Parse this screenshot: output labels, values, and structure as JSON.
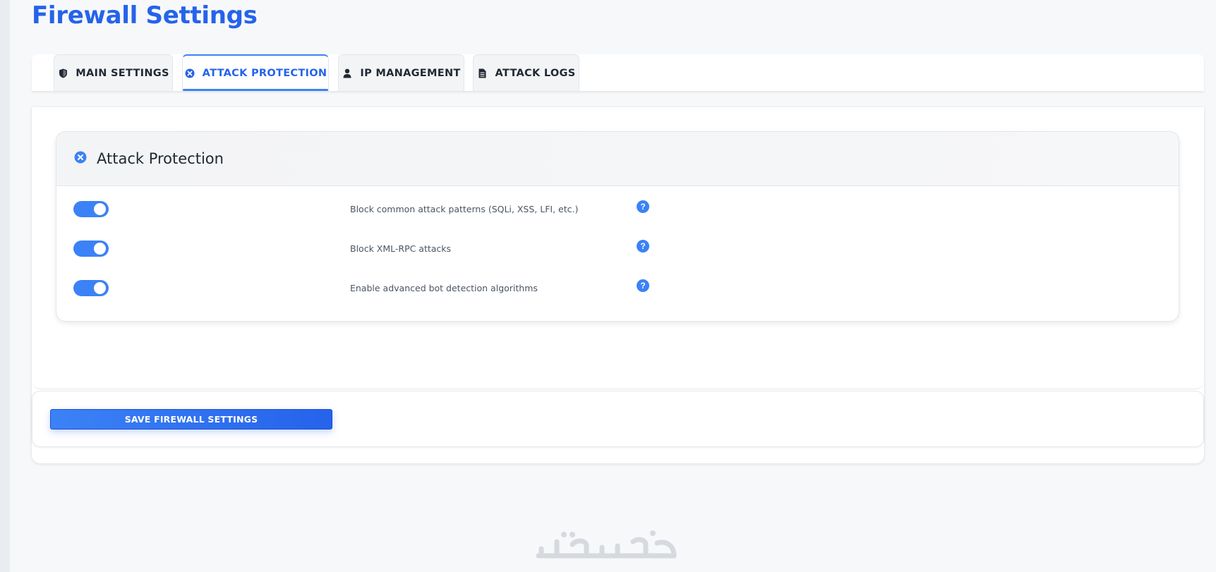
{
  "page": {
    "title": "Firewall Settings"
  },
  "tabs": [
    {
      "label": "MAIN SETTINGS",
      "icon": "shield-icon",
      "active": false
    },
    {
      "label": "ATTACK PROTECTION",
      "icon": "circle-x-icon",
      "active": true
    },
    {
      "label": "IP MANAGEMENT",
      "icon": "user-icon",
      "active": false
    },
    {
      "label": "ATTACK LOGS",
      "icon": "document-icon",
      "active": false
    }
  ],
  "card": {
    "title": "Attack Protection",
    "icon": "circle-x-icon",
    "settings": [
      {
        "label": "Block common attack patterns (SQLi, XSS, LFI, etc.)",
        "enabled": true,
        "help": "?"
      },
      {
        "label": "Block XML-RPC attacks",
        "enabled": true,
        "help": "?"
      },
      {
        "label": "Enable advanced bot detection algorithms",
        "enabled": true,
        "help": "?"
      }
    ]
  },
  "save": {
    "label": "SAVE FIREWALL SETTINGS"
  },
  "watermark": {
    "text": "خمسات"
  },
  "colors": {
    "accent": "#3b82f6",
    "title": "#2563eb",
    "background": "#f7f8fa"
  }
}
